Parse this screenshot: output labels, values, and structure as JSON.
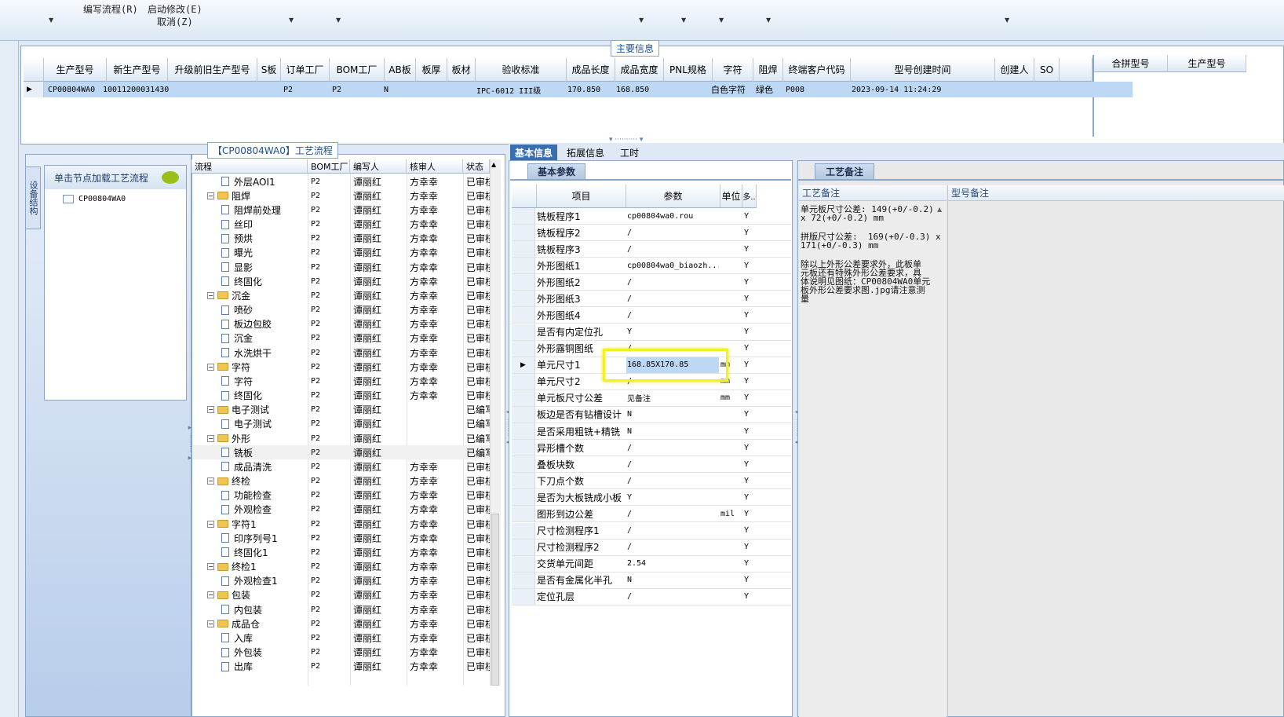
{
  "toolbar": {
    "items": [
      "编写流程(R)",
      "启动修改(E)",
      "取消(Z)"
    ]
  },
  "main_info": {
    "section_label": "主要信息",
    "columns": [
      "生产型号",
      "新生产型号",
      "升级前旧生产型号",
      "S板",
      "订单工厂",
      "BOM工厂",
      "AB板",
      "板厚",
      "板材",
      "验收标准",
      "成品长度",
      "成品宽度",
      "PNL规格",
      "字符",
      "阻焊",
      "终端客户代码",
      "型号创建时间",
      "创建人",
      "SO"
    ],
    "right_columns": [
      "合拼型号",
      "生产型号"
    ],
    "row": {
      "prod_model": "CP00804WA0",
      "new_prod_model": "10011200031430",
      "order_factory": "P2",
      "bom_factory": "P2",
      "ab": "N",
      "standard": "IPC-6012 III级",
      "length": "170.850",
      "width": "168.850",
      "char": "白色字符",
      "solder": "绿色",
      "customer": "P008",
      "created": "2023-09-14 11:24:29"
    }
  },
  "left_nav": {
    "vertical_tab": "设备结构",
    "header": "单击节点加载工艺流程",
    "node": "CP00804WA0"
  },
  "process": {
    "label": "【CP00804WA0】工艺流程",
    "columns": [
      "流程",
      "BOM工厂",
      "编写人",
      "核审人",
      "状态"
    ],
    "rows": [
      {
        "name": "外层AOI1",
        "level": 2,
        "type": "doc",
        "bom": "P2",
        "writer": "谭丽红",
        "reviewer": "方幸幸",
        "status": "已审核"
      },
      {
        "name": "阻焊",
        "level": 1,
        "type": "folder",
        "bom": "P2",
        "writer": "谭丽红",
        "reviewer": "方幸幸",
        "status": "已审核"
      },
      {
        "name": "阻焊前处理",
        "level": 2,
        "type": "doc",
        "bom": "P2",
        "writer": "谭丽红",
        "reviewer": "方幸幸",
        "status": "已审核"
      },
      {
        "name": "丝印",
        "level": 2,
        "type": "doc",
        "bom": "P2",
        "writer": "谭丽红",
        "reviewer": "方幸幸",
        "status": "已审核"
      },
      {
        "name": "预烘",
        "level": 2,
        "type": "doc",
        "bom": "P2",
        "writer": "谭丽红",
        "reviewer": "方幸幸",
        "status": "已审核"
      },
      {
        "name": "曝光",
        "level": 2,
        "type": "doc",
        "bom": "P2",
        "writer": "谭丽红",
        "reviewer": "方幸幸",
        "status": "已审核"
      },
      {
        "name": "显影",
        "level": 2,
        "type": "doc",
        "bom": "P2",
        "writer": "谭丽红",
        "reviewer": "方幸幸",
        "status": "已审核"
      },
      {
        "name": "终固化",
        "level": 2,
        "type": "doc",
        "bom": "P2",
        "writer": "谭丽红",
        "reviewer": "方幸幸",
        "status": "已审核"
      },
      {
        "name": "沉金",
        "level": 1,
        "type": "folder",
        "bom": "P2",
        "writer": "谭丽红",
        "reviewer": "方幸幸",
        "status": "已审核"
      },
      {
        "name": "喷砂",
        "level": 2,
        "type": "doc",
        "bom": "P2",
        "writer": "谭丽红",
        "reviewer": "方幸幸",
        "status": "已审核"
      },
      {
        "name": "板边包胶",
        "level": 2,
        "type": "doc",
        "bom": "P2",
        "writer": "谭丽红",
        "reviewer": "方幸幸",
        "status": "已审核"
      },
      {
        "name": "沉金",
        "level": 2,
        "type": "doc",
        "bom": "P2",
        "writer": "谭丽红",
        "reviewer": "方幸幸",
        "status": "已审核"
      },
      {
        "name": "水洗烘干",
        "level": 2,
        "type": "doc",
        "bom": "P2",
        "writer": "谭丽红",
        "reviewer": "方幸幸",
        "status": "已审核"
      },
      {
        "name": "字符",
        "level": 1,
        "type": "folder",
        "bom": "P2",
        "writer": "谭丽红",
        "reviewer": "方幸幸",
        "status": "已审核"
      },
      {
        "name": "字符",
        "level": 2,
        "type": "doc",
        "bom": "P2",
        "writer": "谭丽红",
        "reviewer": "方幸幸",
        "status": "已审核"
      },
      {
        "name": "终固化",
        "level": 2,
        "type": "doc",
        "bom": "P2",
        "writer": "谭丽红",
        "reviewer": "方幸幸",
        "status": "已审核"
      },
      {
        "name": "电子测试",
        "level": 1,
        "type": "folder",
        "bom": "P2",
        "writer": "谭丽红",
        "reviewer": "",
        "status": "已编写"
      },
      {
        "name": "电子测试",
        "level": 2,
        "type": "doc",
        "bom": "P2",
        "writer": "谭丽红",
        "reviewer": "",
        "status": "已编写"
      },
      {
        "name": "外形",
        "level": 1,
        "type": "folder",
        "bom": "P2",
        "writer": "谭丽红",
        "reviewer": "",
        "status": "已编写"
      },
      {
        "name": "铣板",
        "level": 2,
        "type": "doc",
        "bom": "P2",
        "writer": "谭丽红",
        "reviewer": "",
        "status": "已编写",
        "selected": true
      },
      {
        "name": "成品清洗",
        "level": 2,
        "type": "doc",
        "bom": "P2",
        "writer": "谭丽红",
        "reviewer": "方幸幸",
        "status": "已审核"
      },
      {
        "name": "终检",
        "level": 1,
        "type": "folder",
        "bom": "P2",
        "writer": "谭丽红",
        "reviewer": "方幸幸",
        "status": "已审核"
      },
      {
        "name": "功能检查",
        "level": 2,
        "type": "doc",
        "bom": "P2",
        "writer": "谭丽红",
        "reviewer": "方幸幸",
        "status": "已审核"
      },
      {
        "name": "外观检查",
        "level": 2,
        "type": "doc",
        "bom": "P2",
        "writer": "谭丽红",
        "reviewer": "方幸幸",
        "status": "已审核"
      },
      {
        "name": "字符1",
        "level": 1,
        "type": "folder",
        "bom": "P2",
        "writer": "谭丽红",
        "reviewer": "方幸幸",
        "status": "已审核"
      },
      {
        "name": "印序列号1",
        "level": 2,
        "type": "doc",
        "bom": "P2",
        "writer": "谭丽红",
        "reviewer": "方幸幸",
        "status": "已审核"
      },
      {
        "name": "终固化1",
        "level": 2,
        "type": "doc",
        "bom": "P2",
        "writer": "谭丽红",
        "reviewer": "方幸幸",
        "status": "已审核"
      },
      {
        "name": "终检1",
        "level": 1,
        "type": "folder",
        "bom": "P2",
        "writer": "谭丽红",
        "reviewer": "方幸幸",
        "status": "已审核"
      },
      {
        "name": "外观检查1",
        "level": 2,
        "type": "doc",
        "bom": "P2",
        "writer": "谭丽红",
        "reviewer": "方幸幸",
        "status": "已审核"
      },
      {
        "name": "包装",
        "level": 1,
        "type": "folder",
        "bom": "P2",
        "writer": "谭丽红",
        "reviewer": "方幸幸",
        "status": "已审核"
      },
      {
        "name": "内包装",
        "level": 2,
        "type": "doc",
        "bom": "P2",
        "writer": "谭丽红",
        "reviewer": "方幸幸",
        "status": "已审核"
      },
      {
        "name": "成品仓",
        "level": 1,
        "type": "folder",
        "bom": "P2",
        "writer": "谭丽红",
        "reviewer": "方幸幸",
        "status": "已审核"
      },
      {
        "name": "入库",
        "level": 2,
        "type": "doc",
        "bom": "P2",
        "writer": "谭丽红",
        "reviewer": "方幸幸",
        "status": "已审核"
      },
      {
        "name": "外包装",
        "level": 2,
        "type": "doc",
        "bom": "P2",
        "writer": "谭丽红",
        "reviewer": "方幸幸",
        "status": "已审核"
      },
      {
        "name": "出库",
        "level": 2,
        "type": "doc",
        "bom": "P2",
        "writer": "谭丽红",
        "reviewer": "方幸幸",
        "status": "已审核"
      }
    ]
  },
  "tabs": {
    "basic": "基本信息",
    "extended": "拓展信息",
    "hours": "工时"
  },
  "basic": {
    "subtab": "基本参数",
    "columns": [
      "项目",
      "参数",
      "单位",
      "多.."
    ],
    "rows": [
      {
        "name": "铣板程序1",
        "value": "cp00804wa0.rou",
        "unit": "",
        "flag": "Y"
      },
      {
        "name": "铣板程序2",
        "value": "/",
        "unit": "",
        "flag": "Y"
      },
      {
        "name": "铣板程序3",
        "value": "/",
        "unit": "",
        "flag": "Y"
      },
      {
        "name": "外形图纸1",
        "value": "cp00804wa0_biaozh...",
        "unit": "",
        "flag": "Y"
      },
      {
        "name": "外形图纸2",
        "value": "/",
        "unit": "",
        "flag": "Y"
      },
      {
        "name": "外形图纸3",
        "value": "/",
        "unit": "",
        "flag": "Y"
      },
      {
        "name": "外形图纸4",
        "value": "/",
        "unit": "",
        "flag": "Y"
      },
      {
        "name": "是否有内定位孔",
        "value": "Y",
        "unit": "",
        "flag": "Y"
      },
      {
        "name": "外形露铜图纸",
        "value": "/",
        "unit": "",
        "flag": "Y"
      },
      {
        "name": "单元尺寸1",
        "value": "168.85X170.85",
        "unit": "mm",
        "flag": "Y",
        "selected": true
      },
      {
        "name": "单元尺寸2",
        "value": "/",
        "unit": "mm",
        "flag": "Y"
      },
      {
        "name": "单元板尺寸公差",
        "value": "见备注",
        "unit": "mm",
        "flag": "Y"
      },
      {
        "name": "板边是否有钻槽设计",
        "value": "N",
        "unit": "",
        "flag": "Y"
      },
      {
        "name": "是否采用粗铣+精铣",
        "value": "N",
        "unit": "",
        "flag": "Y"
      },
      {
        "name": "异形槽个数",
        "value": "/",
        "unit": "",
        "flag": "Y"
      },
      {
        "name": "叠板块数",
        "value": "/",
        "unit": "",
        "flag": "Y"
      },
      {
        "name": "下刀点个数",
        "value": "/",
        "unit": "",
        "flag": "Y"
      },
      {
        "name": "是否为大板铣成小板",
        "value": "Y",
        "unit": "",
        "flag": "Y"
      },
      {
        "name": "图形到边公差",
        "value": "/",
        "unit": "mil",
        "flag": "Y"
      },
      {
        "name": "尺寸检测程序1",
        "value": "/",
        "unit": "",
        "flag": "Y"
      },
      {
        "name": "尺寸检测程序2",
        "value": "/",
        "unit": "",
        "flag": "Y"
      },
      {
        "name": "交货单元间距",
        "value": "2.54",
        "unit": "",
        "flag": "Y"
      },
      {
        "name": "是否有金属化半孔",
        "value": "N",
        "unit": "",
        "flag": "Y"
      },
      {
        "name": "定位孔层",
        "value": "/",
        "unit": "",
        "flag": "Y"
      }
    ]
  },
  "notes": {
    "subtab": "工艺备注",
    "col1": "工艺备注",
    "col2": "型号备注",
    "para1": "单元板尺寸公差: 149(+0/-0.2)\nx 72(+0/-0.2) mm",
    "para2": "拼版尺寸公差:  169(+0/-0.3) x\n171(+0/-0.3) mm",
    "para3": "除以上外形公差要求外，此板单\n元板还有特殊外形公差要求，具\n体说明见图纸：CP00804WA0单元\n板外形公差要求图.jpg请注意测\n量"
  }
}
